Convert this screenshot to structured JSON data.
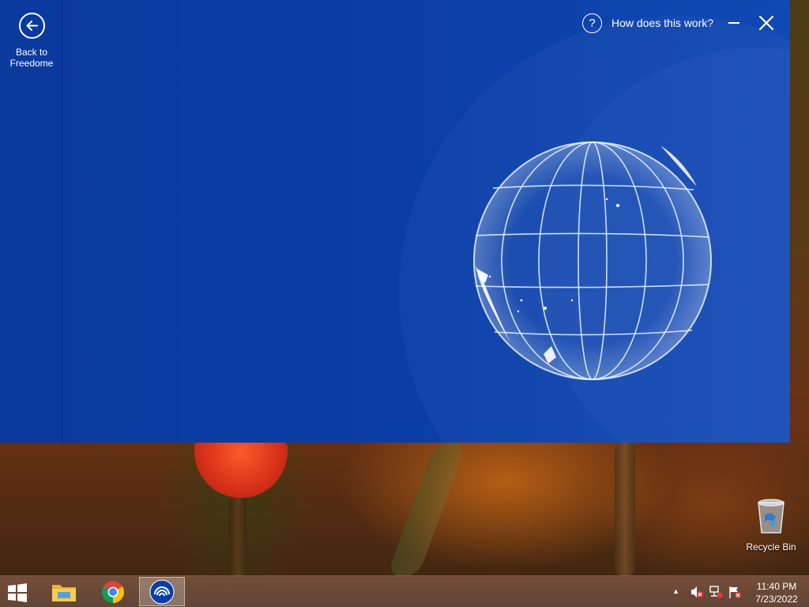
{
  "app": {
    "back_label_line1": "Back to",
    "back_label_line2": "Freedome",
    "help_label": "How does this work?",
    "icons": [
      "back-arrow-icon",
      "help-icon",
      "minimize-icon",
      "close-icon",
      "globe-illustration"
    ]
  },
  "desktop": {
    "recycle_bin_label": "Recycle Bin"
  },
  "taskbar": {
    "apps": [
      "start",
      "file-explorer",
      "chrome",
      "freedome"
    ],
    "clock_time": "11:40 PM",
    "clock_date": "7/23/2022"
  },
  "colors": {
    "app_background": "#0a3da6",
    "accent_white": "#ffffff"
  }
}
